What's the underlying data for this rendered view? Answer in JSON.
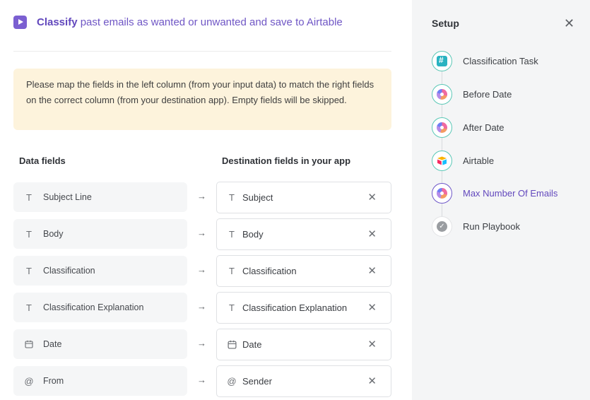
{
  "header": {
    "title_bold": "Classify",
    "title_rest": " past emails as wanted or unwanted and save to Airtable"
  },
  "notice": "Please map the fields in the left column (from your input data) to match the right fields on the correct column (from your destination app). Empty fields will be skipped.",
  "columns": {
    "left": "Data fields",
    "right": "Destination fields in your app"
  },
  "mappings": [
    {
      "source": "Subject Line",
      "dest": "Subject",
      "icon": "text-type-icon"
    },
    {
      "source": "Body",
      "dest": "Body",
      "icon": "text-type-icon"
    },
    {
      "source": "Classification",
      "dest": "Classification",
      "icon": "text-type-icon"
    },
    {
      "source": "Classification Explanation",
      "dest": "Classification Explanation",
      "icon": "text-type-icon"
    },
    {
      "source": "Date",
      "dest": "Date",
      "icon": "calendar-icon"
    },
    {
      "source": "From",
      "dest": "Sender",
      "icon": "at-sign-icon"
    }
  ],
  "glyphs": {
    "arrow": "→",
    "close": "✕",
    "text": "T",
    "at": "@",
    "check": "✓",
    "calendar": "🗓"
  },
  "setup": {
    "title": "Setup",
    "steps": [
      {
        "label": "Classification Task",
        "state": "done",
        "icon": "grid-app-icon"
      },
      {
        "label": "Before Date",
        "state": "done",
        "icon": "color-blob-icon"
      },
      {
        "label": "After Date",
        "state": "done",
        "icon": "color-blob-icon"
      },
      {
        "label": "Airtable",
        "state": "done",
        "icon": "airtable-icon"
      },
      {
        "label": "Max Number Of Emails",
        "state": "active",
        "icon": "color-blob-icon"
      },
      {
        "label": "Run Playbook",
        "state": "pending",
        "icon": "check-circle-icon"
      }
    ]
  },
  "colors": {
    "accent": "#6248bd",
    "done_ring": "#5cc8b7",
    "notice_bg": "#fdf3dc",
    "sidebar_bg": "#f4f5f6"
  }
}
